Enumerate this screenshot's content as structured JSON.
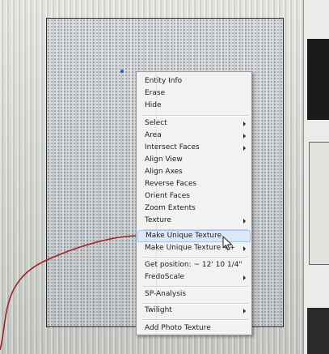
{
  "context_menu": {
    "items": [
      {
        "label": "Entity Info"
      },
      {
        "label": "Erase"
      },
      {
        "label": "Hide"
      },
      {
        "label": "Select"
      },
      {
        "label": "Area"
      },
      {
        "label": "Intersect Faces"
      },
      {
        "label": "Align View"
      },
      {
        "label": "Align Axes"
      },
      {
        "label": "Reverse Faces"
      },
      {
        "label": "Orient Faces"
      },
      {
        "label": "Zoom Extents"
      },
      {
        "label": "Texture"
      },
      {
        "label": "Make Unique Texture"
      },
      {
        "label": "Make Unique Texture ++"
      },
      {
        "label": "Get position: ~ 12' 10 1/4\""
      },
      {
        "label": "FredoScale"
      },
      {
        "label": "SP-Analysis"
      },
      {
        "label": "Twilight"
      },
      {
        "label": "Add Photo Texture"
      }
    ]
  },
  "colors": {
    "highlight": "#dce8f6",
    "annotation_curve": "#a12020",
    "selection_dots": "#3c466e"
  },
  "icons": [
    "submenu-arrow-icon",
    "mouse-pointer-icon"
  ]
}
